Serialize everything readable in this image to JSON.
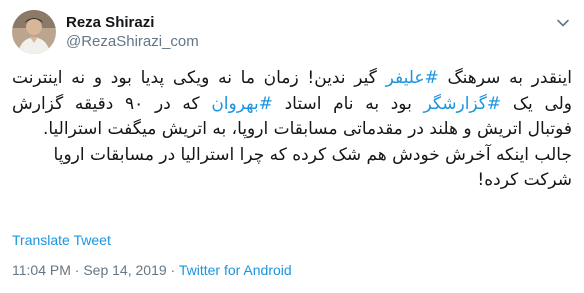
{
  "author": {
    "name": "Reza Shirazi",
    "handle": "@RezaShirazi_com"
  },
  "tweet": {
    "lines": [
      [
        {
          "text": "اینقدر به سرهنگ "
        },
        {
          "text": "#علیفر",
          "hashtag": true
        },
        {
          "text": " گیر ندین! زمان ما نه ویکی پدیا بود و نه اینترنت"
        }
      ],
      [
        {
          "text": "ولی یک "
        },
        {
          "text": "#گزارشگر",
          "hashtag": true
        },
        {
          "text": " بود به نام استاد "
        },
        {
          "text": "#بهروان",
          "hashtag": true
        },
        {
          "text": " که  در ۹۰ دقیقه گزارش"
        }
      ],
      [
        {
          "text": "فوتبال اتریش و هلند در مقدماتی مسابقات اروپا، به اتریش میگفت استرالیا."
        }
      ],
      [
        {
          "text": "جالب اینکه آخرش خودش هم شک کرده که چرا استرالیا در مسابقات اروپا"
        }
      ],
      [
        {
          "text": "شرکت کرده!"
        }
      ]
    ]
  },
  "actions": {
    "translate_label": "Translate Tweet"
  },
  "meta": {
    "time": "11:04 PM",
    "separator": "·",
    "date": "Sep 14, 2019",
    "app": "Twitter for Android"
  },
  "colors": {
    "link": "#1b95e0",
    "text": "#14171a",
    "secondary": "#657786"
  },
  "icons": {
    "menu": "chevron-down-icon",
    "avatar": "avatar"
  }
}
